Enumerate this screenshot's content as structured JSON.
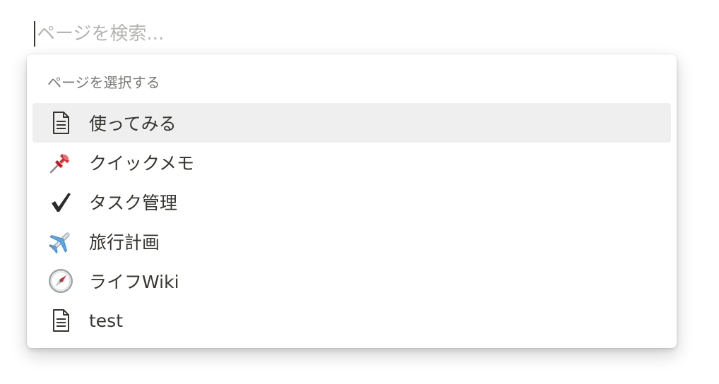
{
  "search": {
    "placeholder": "ページを検索...",
    "value": ""
  },
  "menu": {
    "heading": "ページを選択する",
    "items": [
      {
        "label": "使ってみる",
        "icon": "document-icon",
        "selected": true
      },
      {
        "label": "クイックメモ",
        "icon": "pushpin-icon",
        "selected": false
      },
      {
        "label": "タスク管理",
        "icon": "checkmark-icon",
        "selected": false
      },
      {
        "label": "旅行計画",
        "icon": "airplane-icon",
        "selected": false
      },
      {
        "label": "ライフWiki",
        "icon": "compass-icon",
        "selected": false
      },
      {
        "label": "test",
        "icon": "document-icon",
        "selected": false
      }
    ]
  },
  "colors": {
    "text": "#37352f",
    "placeholder": "#b4b4b0",
    "heading": "#7a7974",
    "selected_bg": "#efefef",
    "pushpin_red": "#d8262e",
    "airplane_blue": "#5aa9e6"
  }
}
